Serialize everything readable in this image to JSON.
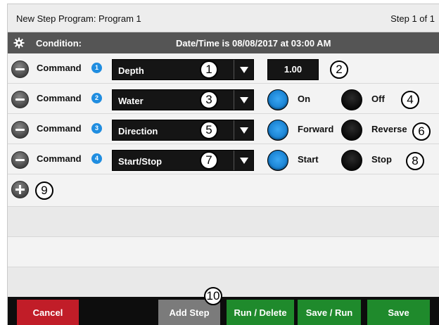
{
  "header": {
    "title": "New Step Program:  Program 1",
    "step": "Step 1 of 1"
  },
  "condition": {
    "icon": "gear-icon",
    "label": "Condition:",
    "text": "Date/Time is 08/08/2017 at 03:00 AM"
  },
  "commands": [
    {
      "label": "Command",
      "number": "1",
      "selection": "Depth",
      "value": "1.00"
    },
    {
      "label": "Command",
      "number": "2",
      "selection": "Water",
      "option_a": "On",
      "option_b": "Off",
      "selected": "On"
    },
    {
      "label": "Command",
      "number": "3",
      "selection": "Direction",
      "option_a": "Forward",
      "option_b": "Reverse",
      "selected": "Forward"
    },
    {
      "label": "Command",
      "number": "4",
      "selection": "Start/Stop",
      "option_a": "Start",
      "option_b": "Stop",
      "selected": "Start"
    }
  ],
  "callouts": [
    "1",
    "2",
    "3",
    "4",
    "5",
    "6",
    "7",
    "8",
    "9",
    "10"
  ],
  "buttons": {
    "cancel": "Cancel",
    "add_step": "Add Step",
    "run_delete": "Run / Delete",
    "save_run": "Save / Run",
    "save": "Save"
  },
  "colors": {
    "accent_blue": "#1f8de0",
    "cancel_red": "#c11d28",
    "save_green": "#1f8a2c",
    "condition_bar": "#555555"
  }
}
